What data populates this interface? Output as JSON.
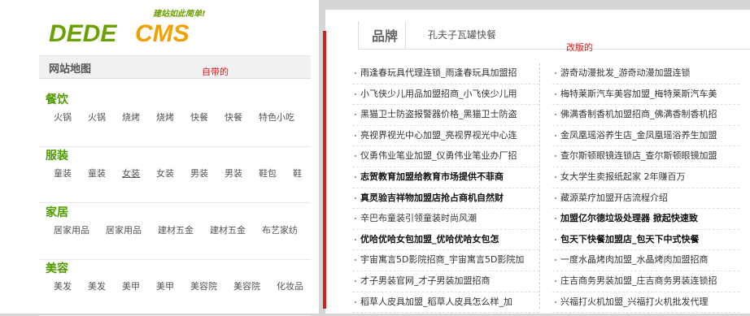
{
  "logo": {
    "text_green": "DEDE",
    "text_orange": "CMS",
    "slogan": "建站如此简单!"
  },
  "sitemap": {
    "title": "网站地图"
  },
  "notes": {
    "left": "自带的",
    "right": "改版的"
  },
  "categories": [
    {
      "title": "餐饮",
      "links": [
        "火锅",
        "火锅",
        "烧烤",
        "烧烤",
        "快餐",
        "快餐",
        "特色小吃"
      ]
    },
    {
      "title": "服装",
      "links": [
        "童装",
        "童装",
        "女装",
        "女装",
        "男装",
        "男装",
        "鞋包",
        "鞋"
      ]
    },
    {
      "title": "家居",
      "links": [
        "居家用品",
        "居家用品",
        "建材五金",
        "建材五金",
        "布艺家纺"
      ]
    },
    {
      "title": "美容",
      "links": [
        "美发",
        "美发",
        "美甲",
        "美甲",
        "美容院",
        "美容院",
        "化妆品"
      ]
    }
  ],
  "brand": {
    "tab": "品牌",
    "subtitle": "孔夫子瓦罐快餐"
  },
  "list": {
    "left": [
      {
        "text": "雨逢春玩具代理连锁_雨逢春玩具加盟招",
        "bold": false
      },
      {
        "text": "小飞侠少儿用品加盟招商_小飞侠少儿用",
        "bold": false
      },
      {
        "text": "黑猫卫士防盗报警器价格_黑猫卫士防盗",
        "bold": false
      },
      {
        "text": "亮视界视光中心加盟_亮视界视光中心连",
        "bold": false
      },
      {
        "text": "仪勇伟业笔业加盟_仪勇伟业笔业办厂招",
        "bold": false
      },
      {
        "text": "志贺教育加盟给教育市场提供不菲商",
        "bold": true
      },
      {
        "text": "真灵验吉祥物加盟店抢占商机自然财",
        "bold": true
      },
      {
        "text": "辛巴布童装引领童装时尚风潮",
        "bold": false
      },
      {
        "text": "优哈优哈女包加盟_优哈优哈女包怎",
        "bold": true
      },
      {
        "text": "宇宙寓言5D影院招商_宇宙寓言5D影院加",
        "bold": false
      },
      {
        "text": "才子男装官网_才子男装加盟招商",
        "bold": false
      },
      {
        "text": "稻草人皮具加盟_稻草人皮具怎么样_加",
        "bold": false
      }
    ],
    "right": [
      {
        "text": "游奇动漫批发_游奇动漫加盟连锁",
        "bold": false
      },
      {
        "text": "梅特莱斯汽车美容加盟_梅特莱斯汽车美",
        "bold": false
      },
      {
        "text": "佛满香制香机加盟招商_佛满香制香机招",
        "bold": false
      },
      {
        "text": "金凤凰瑶浴养生店_金凤凰瑶浴养生加盟",
        "bold": false
      },
      {
        "text": "查尔斯顿眼镜连锁店_查尔斯顿眼镜加盟",
        "bold": false
      },
      {
        "text": "女大学生卖报纸起家 2年赚百万",
        "bold": false
      },
      {
        "text": "藏源菜疗加盟开店流程介绍",
        "bold": false
      },
      {
        "text": "加盟亿尔德垃圾处理器 掀起快速致",
        "bold": true
      },
      {
        "text": "包天下快餐加盟店_包天下中式快餐",
        "bold": true
      },
      {
        "text": "一度水晶烤肉加盟_水晶烤肉加盟招商",
        "bold": false
      },
      {
        "text": "庄吉商务男装加盟_庄吉商务男装连锁招",
        "bold": false
      },
      {
        "text": "兴福打火机加盟_兴福打火机批发代理",
        "bold": false
      }
    ]
  }
}
